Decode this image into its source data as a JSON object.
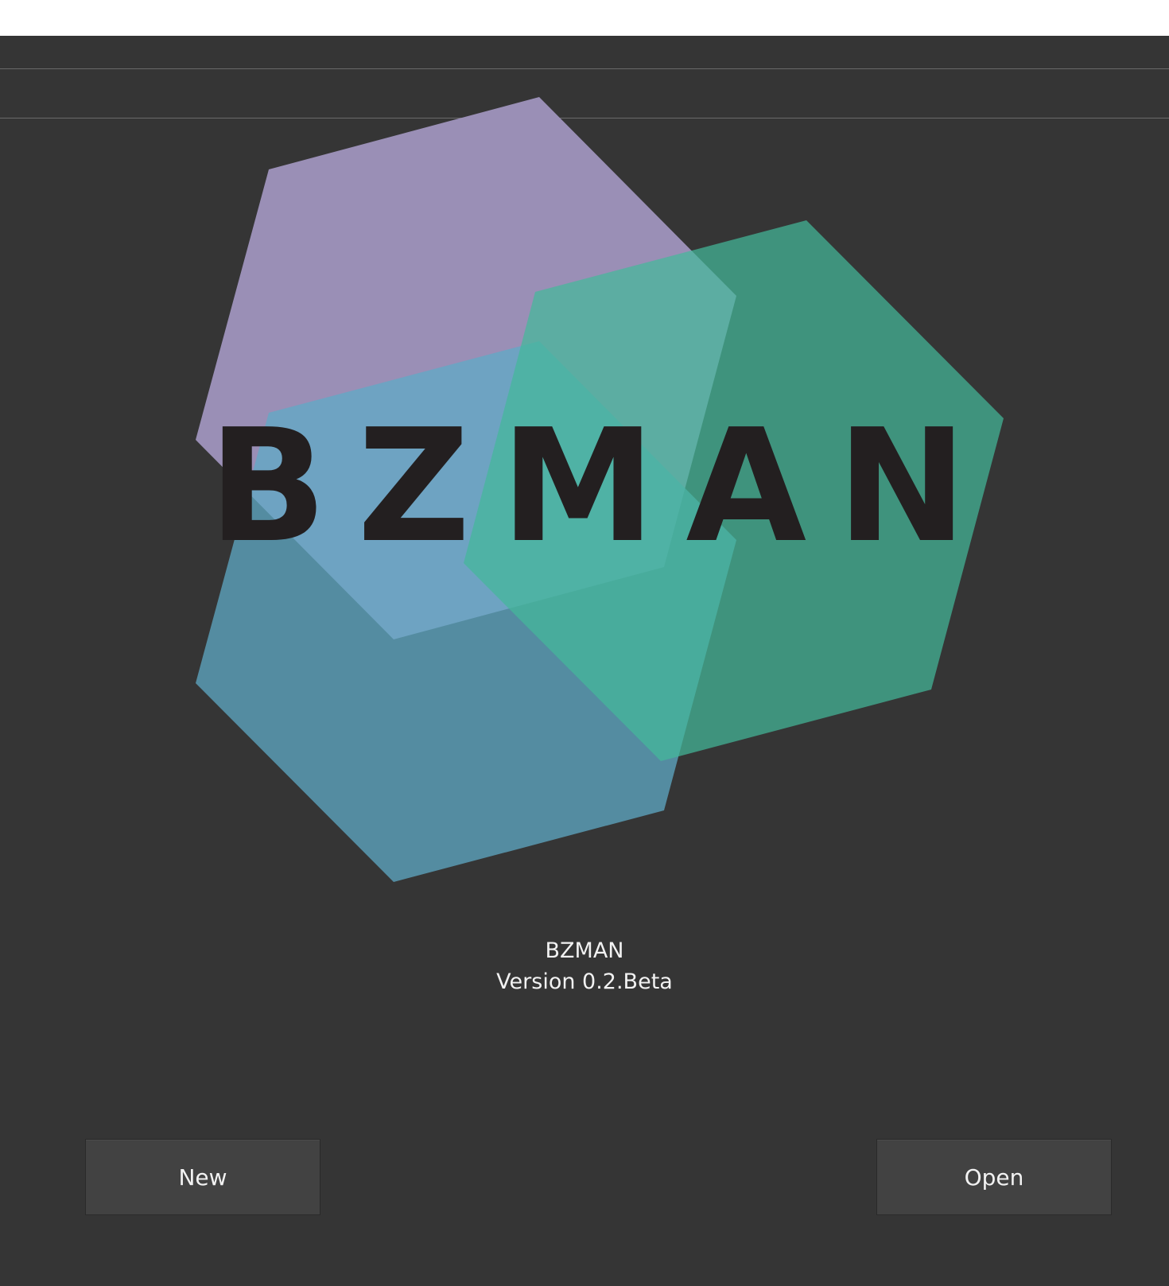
{
  "logo": {
    "wordmark": "BZMAN",
    "colors": {
      "purple_hexagon": "#9a8fb6",
      "green_hexagon": "#459079",
      "teal_hexagon": "#5fa9c6",
      "wordmark": "#231f20"
    }
  },
  "about": {
    "app_name": "BZMAN",
    "version": "Version 0.2.Beta"
  },
  "actions": {
    "new_label": "New",
    "open_label": "Open"
  },
  "theme": {
    "background": "#353535",
    "button_background": "#424242",
    "text": "#f2f2f2"
  }
}
